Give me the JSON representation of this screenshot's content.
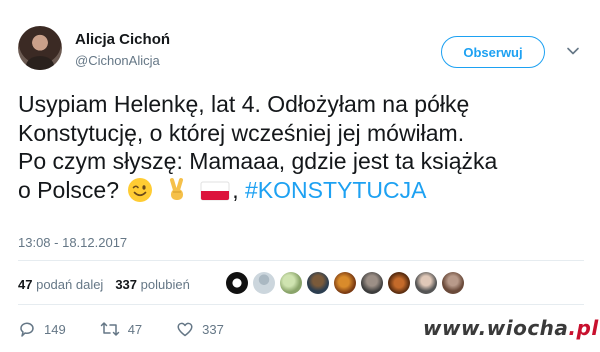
{
  "author": {
    "name": "Alicja Cichoń",
    "handle": "@CichonAlicja"
  },
  "follow_label": "Obserwuj",
  "tweet": {
    "lines": [
      "Usypiam Helenkę, lat 4. Odłożyłam na półkę",
      "Konstytucję, o której wcześniej jej mówiłam.",
      "Po czym słyszę: Mamaaa, gdzie jest ta książka",
      "o Polsce?"
    ],
    "separator": ",",
    "hashtag": "#KONSTYTUCJA",
    "emojis": [
      "winking-face-emoji",
      "victory-hand-emoji",
      "poland-flag-emoji"
    ]
  },
  "timestamp": "13:08 - 18.12.2017",
  "stats": {
    "retweets_count": "47",
    "retweets_label": "podań dalej",
    "likes_count": "337",
    "likes_label": "polubień"
  },
  "liker_avatars": 9,
  "actions": {
    "reply_count": "149",
    "retweet_count": "47",
    "like_count": "337"
  },
  "colors": {
    "accent": "#1da1f2",
    "text": "#14171a",
    "muted": "#657786",
    "divider": "#e6ecf0"
  },
  "watermark": {
    "main": "www.wiocha",
    "tld": ".pl"
  }
}
